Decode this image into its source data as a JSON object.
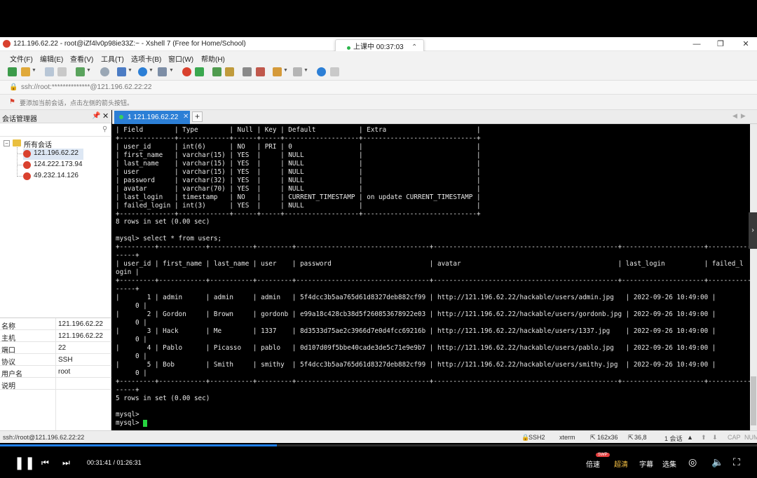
{
  "window": {
    "title": "121.196.62.22 - root@iZf4lv0p98ie33Z:~ - Xshell 7 (Free for Home/School)",
    "lesson_status": "上课中 00:37:03"
  },
  "menu": [
    "文件(F)",
    "编辑(E)",
    "查看(V)",
    "工具(T)",
    "选项卡(B)",
    "窗口(W)",
    "帮助(H)"
  ],
  "address": "ssh://root:**************@121.196.62.22:22",
  "hint": "要添加当前会话，点击左侧的箭头按钮。",
  "sidebar": {
    "title": "会话管理器",
    "root_label": "所有会话",
    "sessions": [
      "121.196.62.22",
      "124.222.173.94",
      "49.232.14.126"
    ],
    "properties": [
      {
        "key": "名称",
        "value": "121.196.62.22"
      },
      {
        "key": "主机",
        "value": "121.196.62.22"
      },
      {
        "key": "端口",
        "value": "22"
      },
      {
        "key": "协议",
        "value": "SSH"
      },
      {
        "key": "用户名",
        "value": "root"
      },
      {
        "key": "说明",
        "value": ""
      }
    ]
  },
  "tab": {
    "label": "1 121.196.62.22"
  },
  "terminal": {
    "lines": [
      "| Field        | Type        | Null | Key | Default           | Extra                       |",
      "+--------------+-------------+------+-----+-------------------+-----------------------------+",
      "| user_id      | int(6)      | NO   | PRI | 0                 |                             |",
      "| first_name   | varchar(15) | YES  |     | NULL              |                             |",
      "| last_name    | varchar(15) | YES  |     | NULL              |                             |",
      "| user         | varchar(15) | YES  |     | NULL              |                             |",
      "| password     | varchar(32) | YES  |     | NULL              |                             |",
      "| avatar       | varchar(70) | YES  |     | NULL              |                             |",
      "| last_login   | timestamp   | NO   |     | CURRENT_TIMESTAMP | on update CURRENT_TIMESTAMP |",
      "| failed_login | int(3)      | YES  |     | NULL              |                             |",
      "+--------------+-------------+------+-----+-------------------+-----------------------------+",
      "8 rows in set (0.00 sec)",
      "",
      "mysql> select * from users;",
      "+---------+------------+-----------+---------+----------------------------------+-----------------------------------------------+---------------------+---------------",
      "-----+",
      "| user_id | first_name | last_name | user    | password                         | avatar                                        | last_login          | failed_l",
      "ogin |",
      "+---------+------------+-----------+---------+----------------------------------+-----------------------------------------------+---------------------+---------------",
      "-----+",
      "|       1 | admin      | admin     | admin   | 5f4dcc3b5aa765d61d8327deb882cf99 | http://121.196.62.22/hackable/users/admin.jpg   | 2022-09-26 10:49:00 |",
      "     0 |",
      "|       2 | Gordon     | Brown     | gordonb | e99a18c428cb38d5f260853678922e03 | http://121.196.62.22/hackable/users/gordonb.jpg | 2022-09-26 10:49:00 |",
      "     0 |",
      "|       3 | Hack       | Me        | 1337    | 8d3533d75ae2c3966d7e0d4fcc69216b | http://121.196.62.22/hackable/users/1337.jpg    | 2022-09-26 10:49:00 |",
      "     0 |",
      "|       4 | Pablo      | Picasso   | pablo   | 0d107d09f5bbe40cade3de5c71e9e9b7 | http://121.196.62.22/hackable/users/pablo.jpg   | 2022-09-26 10:49:00 |",
      "     0 |",
      "|       5 | Bob        | Smith     | smithy  | 5f4dcc3b5aa765d61d8327deb882cf99 | http://121.196.62.22/hackable/users/smithy.jpg  | 2022-09-26 10:49:00 |",
      "     0 |",
      "+---------+------------+-----------+---------+----------------------------------+-----------------------------------------------+---------------------+---------------",
      "-----+",
      "5 rows in set (0.00 sec)",
      "",
      "mysql>",
      "mysql> "
    ]
  },
  "statusbar": {
    "connection": "ssh://root@121.196.62.22:22",
    "protocol": "SSH2",
    "terminal_type": "xterm",
    "size": "162x36",
    "cursor_pos": "36,8",
    "sessions": "1 会话",
    "cap": "CAP",
    "num": "NUM"
  },
  "player": {
    "time": "00:31:41 / 01:26:31",
    "progress": 0.366,
    "speed_label": "倍速",
    "swp_badge": "SWP",
    "quality_label": "超清",
    "subtitle_label": "字幕",
    "episodes_label": "选集"
  },
  "colors": {
    "tab_active": "#2c7fd6",
    "terminal_bg": "#000000",
    "cursor": "#26d43f",
    "progress": "#1e7ee8",
    "quality_text": "#f7c244"
  }
}
